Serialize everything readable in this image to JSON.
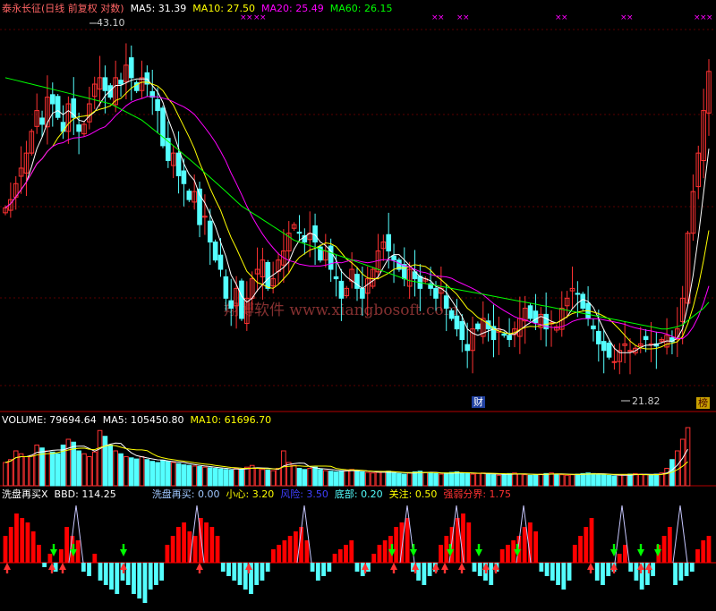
{
  "colors": {
    "background": "#000000",
    "up_candle": "#ff3232",
    "down_candle": "#54ffff",
    "ma5": "#ffffff",
    "ma10": "#ffff00",
    "ma20": "#ff00ff",
    "ma60": "#00ff00",
    "grid": "#b40000",
    "red_bar": "#ff0000",
    "cyan_bar": "#54ffff"
  },
  "price_panel": {
    "title": "泰永长征(日线 前复权 对数)",
    "ma5": "MA5: 31.39",
    "ma10": "MA10: 27.50",
    "ma20": "MA20: 25.49",
    "ma60": "MA60: 26.15",
    "high_label": "43.10",
    "low_label": "21.82",
    "watermark": "翔博软件 www.xiangbosoft.com",
    "badge_cai": "财",
    "badge_bang": "榜"
  },
  "volume_panel": {
    "label": "VOLUME: 79694.64",
    "ma5": "MA5: 105450.80",
    "ma10": "MA10: 61696.70"
  },
  "indicator_panel": {
    "name": "洗盘再买X",
    "bbd": "BBD: 114.25",
    "wash": "洗盘再买: 0.00",
    "careful": "小心: 3.20",
    "risk": "风险: 3.50",
    "bottom": "底部: 0.20",
    "focus": "关注: 0.50",
    "strength": "强弱分界: 1.75"
  },
  "chart_data": {
    "type": "candlestick",
    "title": "泰永长征(日线 前复权 对数)",
    "y_high_marked": 43.1,
    "y_low_marked": 21.82,
    "moving_averages_latest": {
      "MA5": 31.39,
      "MA10": 27.5,
      "MA20": 25.49,
      "MA60": 26.15
    },
    "close": [
      30.0,
      30.5,
      31.5,
      32.5,
      33.5,
      35.0,
      36.5,
      35.5,
      37.5,
      37.0,
      36.0,
      35.0,
      37.0,
      36.0,
      35.0,
      35.5,
      37.0,
      38.5,
      39.0,
      38.0,
      37.5,
      39.0,
      38.5,
      40.0,
      39.0,
      38.0,
      39.0,
      38.5,
      37.5,
      36.5,
      34.0,
      33.0,
      33.5,
      32.0,
      31.5,
      30.5,
      31.0,
      29.0,
      29.5,
      28.0,
      27.0,
      26.5,
      25.0,
      24.5,
      25.5,
      24.0,
      25.0,
      26.0,
      26.5,
      27.0,
      25.5,
      26.0,
      27.0,
      27.5,
      28.5,
      29.0,
      28.5,
      28.0,
      28.5,
      28.0,
      27.0,
      27.5,
      26.5,
      26.0,
      25.0,
      25.5,
      26.5,
      25.5,
      25.0,
      26.0,
      26.5,
      27.5,
      28.0,
      27.5,
      27.0,
      26.5,
      26.0,
      26.5,
      26.0,
      25.5,
      26.0,
      25.5,
      25.0,
      25.5,
      24.5,
      24.0,
      23.5,
      23.0,
      22.5,
      23.5,
      23.5,
      24.0,
      23.5,
      23.0,
      23.5,
      23.2,
      23.0,
      23.5,
      24.0,
      24.5,
      24.0,
      23.8,
      24.2,
      23.5,
      23.8,
      23.6,
      24.5,
      25.0,
      25.5,
      25.2,
      24.5,
      24.0,
      23.5,
      22.8,
      22.5,
      22.2,
      22.0,
      22.5,
      22.8,
      22.5,
      22.6,
      22.8,
      23.0,
      22.8,
      22.7,
      23.0,
      23.2,
      22.9,
      23.5,
      25.0,
      28.5,
      31.0,
      33.5,
      36.5,
      39.5
    ],
    "ma60": [
      39.0,
      38.9,
      38.8,
      38.7,
      38.6,
      38.5,
      38.4,
      38.3,
      38.2,
      38.1,
      38.0,
      37.9,
      37.8,
      37.7,
      37.6,
      37.5,
      37.4,
      37.3,
      37.2,
      37.1,
      37.0,
      36.8,
      36.6,
      36.4,
      36.2,
      36.0,
      35.8,
      35.5,
      35.2,
      34.9,
      34.6,
      34.3,
      34.0,
      33.7,
      33.4,
      33.1,
      32.8,
      32.5,
      32.2,
      31.9,
      31.6,
      31.3,
      31.0,
      30.7,
      30.4,
      30.1,
      29.9,
      29.7,
      29.5,
      29.3,
      29.1,
      28.9,
      28.7,
      28.5,
      28.3,
      28.1,
      28.0,
      27.9,
      27.8,
      27.7,
      27.6,
      27.5,
      27.4,
      27.3,
      27.2,
      27.1,
      27.0,
      26.9,
      26.8,
      26.7,
      26.6,
      26.5,
      26.4,
      26.3,
      26.2,
      26.1,
      26.0,
      25.9,
      25.85,
      25.8,
      25.75,
      25.7,
      25.65,
      25.6,
      25.55,
      25.5,
      25.45,
      25.4,
      25.35,
      25.3,
      25.25,
      25.2,
      25.15,
      25.1,
      25.05,
      25.0,
      24.95,
      24.9,
      24.85,
      24.8,
      24.75,
      24.7,
      24.65,
      24.6,
      24.55,
      24.5,
      24.45,
      24.4,
      24.35,
      24.3,
      24.25,
      24.2,
      24.15,
      24.1,
      24.05,
      24.0,
      23.95,
      23.9,
      23.85,
      23.8,
      23.75,
      23.7,
      23.65,
      23.6,
      23.55,
      23.5,
      23.5,
      23.55,
      23.6,
      23.7,
      23.9,
      24.1,
      24.3,
      24.5,
      24.8
    ],
    "volume": [
      40,
      45,
      60,
      55,
      50,
      52,
      70,
      65,
      60,
      58,
      55,
      70,
      80,
      75,
      60,
      55,
      50,
      58,
      95,
      85,
      70,
      60,
      55,
      50,
      48,
      46,
      50,
      45,
      42,
      40,
      44,
      42,
      40,
      38,
      36,
      35,
      34,
      33,
      32,
      31,
      30,
      29,
      28,
      27,
      30,
      28,
      32,
      35,
      30,
      28,
      27,
      26,
      30,
      60,
      40,
      35,
      30,
      28,
      30,
      32,
      28,
      26,
      25,
      24,
      26,
      27,
      28,
      25,
      24,
      23,
      22,
      23,
      24,
      25,
      22,
      21,
      20,
      22,
      24,
      25,
      23,
      22,
      21,
      20,
      22,
      23,
      24,
      22,
      21,
      20,
      21,
      22,
      20,
      19,
      18,
      20,
      21,
      22,
      20,
      19,
      18,
      19,
      20,
      21,
      22,
      20,
      19,
      18,
      19,
      20,
      21,
      22,
      21,
      20,
      19,
      18,
      17,
      18,
      19,
      20,
      21,
      20,
      19,
      18,
      20,
      22,
      30,
      45,
      60,
      80,
      100
    ],
    "indicator_bars": [
      30,
      40,
      55,
      50,
      45,
      35,
      20,
      -5,
      10,
      -10,
      15,
      40,
      30,
      25,
      -10,
      -15,
      10,
      -20,
      -25,
      -30,
      -35,
      -20,
      -25,
      -35,
      -40,
      -45,
      -30,
      -25,
      -20,
      20,
      30,
      40,
      45,
      35,
      30,
      50,
      45,
      40,
      30,
      -10,
      -15,
      -20,
      -25,
      -30,
      -35,
      -25,
      -20,
      -10,
      15,
      20,
      25,
      30,
      35,
      40,
      25,
      -10,
      -20,
      -15,
      -10,
      10,
      15,
      20,
      25,
      -10,
      -15,
      -10,
      10,
      20,
      25,
      30,
      40,
      45,
      50,
      -10,
      -20,
      -25,
      -15,
      -10,
      20,
      30,
      40,
      50,
      55,
      45,
      -10,
      -15,
      -20,
      -25,
      -10,
      15,
      20,
      25,
      30,
      40,
      45,
      35,
      -10,
      -15,
      -20,
      -25,
      -30,
      -20,
      20,
      30,
      40,
      50,
      -20,
      -25,
      -15,
      -10,
      10,
      20,
      -10,
      -20,
      -30,
      -25,
      -15,
      20,
      30,
      40,
      -25,
      -20,
      -15,
      -10,
      15,
      25,
      30
    ]
  }
}
